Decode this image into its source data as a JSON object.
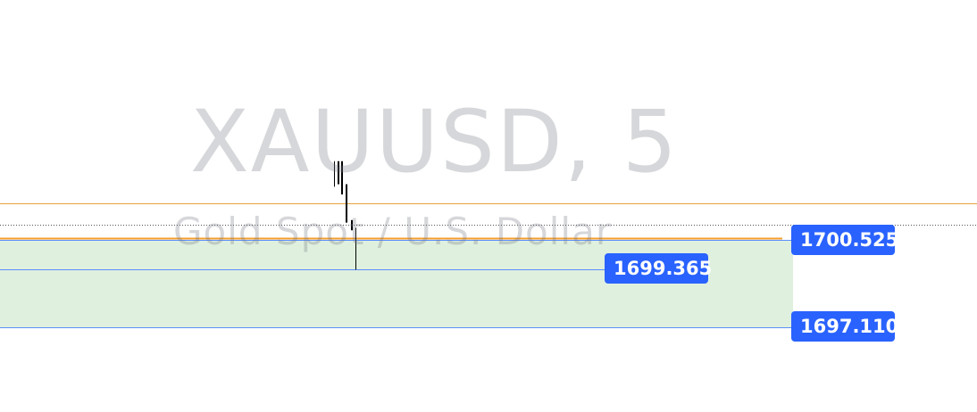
{
  "watermark": {
    "symbol": "XAUUSD, 5",
    "description": "Gold Spot / U.S. Dollar"
  },
  "colors": {
    "background": "#ffffff",
    "zone_fill": "#dff0df",
    "zone_line": "#5b8ff9",
    "tag_bg": "#2962ff",
    "tag_text": "#ffffff",
    "upper_orange": "#e6a13c",
    "main_orange": "#f59d2a",
    "candle": "#000000",
    "dotted": "#555555"
  },
  "chart_data": {
    "type": "line",
    "symbol": "XAUUSD",
    "timeframe": "5",
    "y_range": [
      1695.6,
      1703.6
    ],
    "horizontal_levels": [
      {
        "name": "upper_level",
        "price": 1701.97,
        "color": "#e6a13c",
        "style": "solid"
      },
      {
        "name": "current_price",
        "price": 1701.1,
        "color": "#555555",
        "style": "dotted"
      },
      {
        "name": "orange_level",
        "price": 1700.59,
        "color": "#f59d2a",
        "style": "solid"
      },
      {
        "name": "zone_top",
        "price": 1700.525,
        "label": "1700.525",
        "color": "#5b8ff9",
        "style": "solid"
      },
      {
        "name": "entry",
        "price": 1699.365,
        "label": "1699.365",
        "color": "#5b8ff9",
        "style": "solid"
      },
      {
        "name": "zone_bottom",
        "price": 1697.11,
        "label": "1697.110",
        "color": "#5b8ff9",
        "style": "solid"
      }
    ],
    "zone": {
      "from": 1697.11,
      "to": 1700.525
    },
    "candles": [
      {
        "high": 1703.6,
        "low": 1702.6
      },
      {
        "high": 1703.6,
        "low": 1702.7
      },
      {
        "high": 1703.6,
        "low": 1702.3
      },
      {
        "high": 1702.7,
        "low": 1701.2
      },
      {
        "high": 1701.3,
        "low": 1700.9
      },
      {
        "high": 1701.0,
        "low": 1699.36
      }
    ]
  }
}
